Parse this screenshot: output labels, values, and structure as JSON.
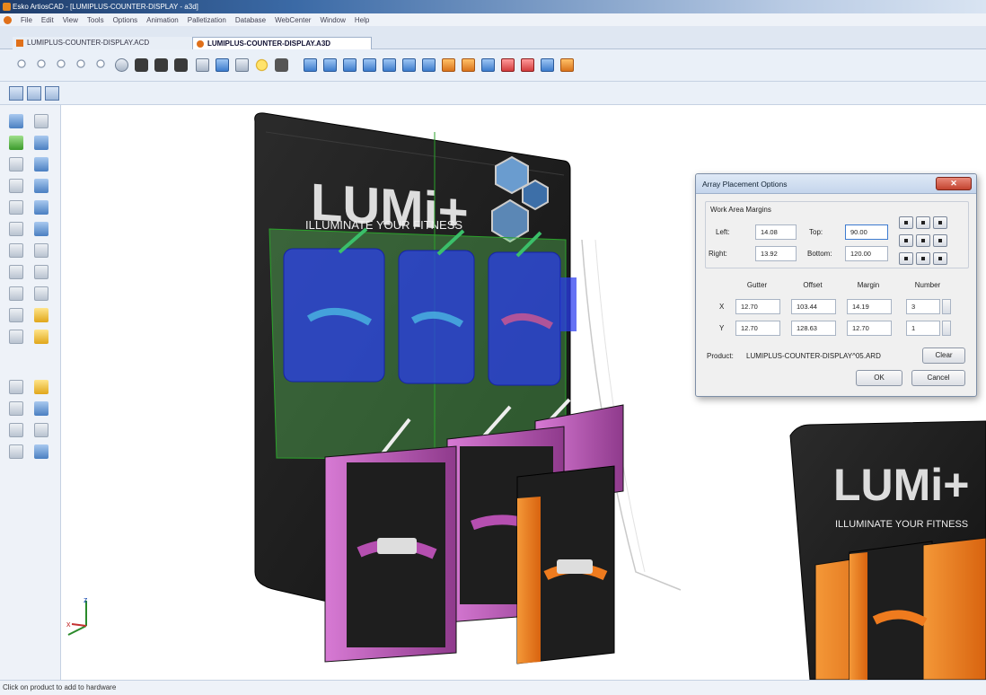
{
  "window": {
    "title": "Esko ArtiosCAD - [LUMIPLUS-COUNTER-DISPLAY - a3d]"
  },
  "menu": [
    "File",
    "Edit",
    "View",
    "Tools",
    "Options",
    "Animation",
    "Palletization",
    "Database",
    "WebCenter",
    "Window",
    "Help"
  ],
  "tabs": [
    {
      "label": "LUMIPLUS-COUNTER-DISPLAY.ACD",
      "active": false
    },
    {
      "label": "LUMIPLUS-COUNTER-DISPLAY.A3D",
      "active": true
    }
  ],
  "scene": {
    "brand": "LUMi+",
    "tagline": "ILLUMINATE YOUR FITNESS",
    "colors": {
      "pink": "#b54fb0",
      "orange": "#ef7b1e",
      "overlay_blue": "#2a3cf0",
      "overlay_green": "#5fd65f",
      "board": "#1c1c1c"
    },
    "axes": {
      "x": "x",
      "z": "z"
    }
  },
  "dialog": {
    "title": "Array Placement Options",
    "close_label": "✕",
    "margins_label": "Work Area Margins",
    "left_label": "Left:",
    "left_value": "14.08",
    "top_label": "Top:",
    "top_value": "90.00",
    "right_label": "Right:",
    "right_value": "13.92",
    "bottom_label": "Bottom:",
    "bottom_value": "120.00",
    "columns": [
      "Gutter",
      "Offset",
      "Margin",
      "Number"
    ],
    "rows": [
      {
        "axis": "X",
        "gutter": "12.70",
        "offset": "103.44",
        "margin": "14.19",
        "number": "3"
      },
      {
        "axis": "Y",
        "gutter": "12.70",
        "offset": "128.63",
        "margin": "12.70",
        "number": "1"
      }
    ],
    "product_label": "Product:",
    "product_value": "LUMIPLUS-COUNTER-DISPLAY^05.ARD",
    "clear_label": "Clear",
    "ok_label": "OK",
    "cancel_label": "Cancel"
  },
  "status": "Click on product to add to hardware"
}
